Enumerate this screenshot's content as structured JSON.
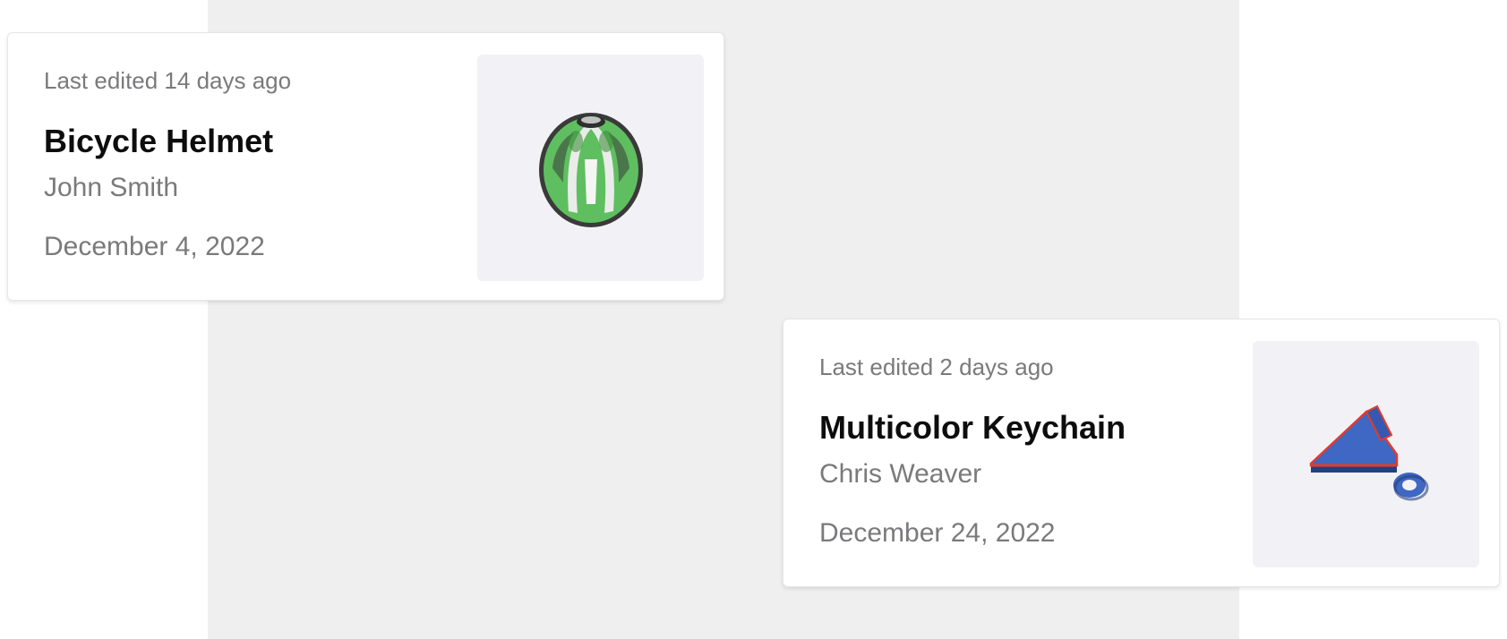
{
  "cards": [
    {
      "last_edited": "Last edited 14 days ago",
      "title": "Bicycle Helmet",
      "author": "John Smith",
      "date": "December 4, 2022",
      "thumbnail_icon": "bicycle-helmet-model",
      "colors": {
        "model": "#5fbf60",
        "accent": "#2f2f2f"
      }
    },
    {
      "last_edited": "Last edited 2 days ago",
      "title": "Multicolor Keychain",
      "author": "Chris Weaver",
      "date": "December 24, 2022",
      "thumbnail_icon": "keychain-model",
      "colors": {
        "model": "#3f67c4",
        "accent": "#e23b2e"
      }
    }
  ]
}
